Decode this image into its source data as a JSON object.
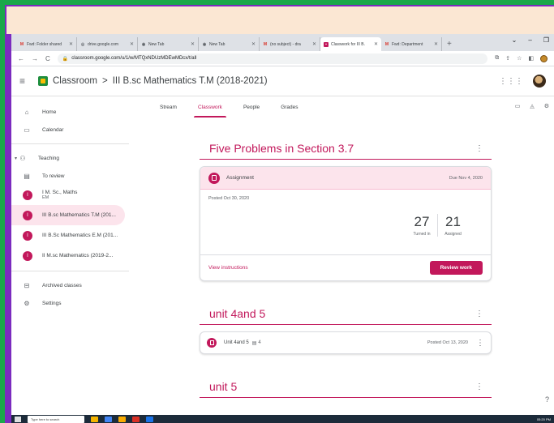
{
  "browser": {
    "tabs": [
      {
        "label": "Fwd: Folder shared",
        "icon": "gmail-icon",
        "active": false
      },
      {
        "label": "drive.google.com",
        "icon": "drive-icon",
        "active": false
      },
      {
        "label": "New Tab",
        "icon": "chrome-icon",
        "active": false
      },
      {
        "label": "New Tab",
        "icon": "chrome-icon",
        "active": false
      },
      {
        "label": "(no subject) - dra",
        "icon": "gmail-icon",
        "active": false
      },
      {
        "label": "Classwork for III B.",
        "icon": "classroom-icon",
        "active": true
      },
      {
        "label": "Fwd: Department",
        "icon": "gmail-icon",
        "active": false
      }
    ],
    "url": "classroom.google.com/u/1/w/MTQxNDUzMDEwMDcx/t/all"
  },
  "header": {
    "app_name": "Classroom",
    "separator": ">",
    "class_name": "III B.sc Mathematics T.M (2018-2021)"
  },
  "subnav": {
    "tabs": [
      {
        "label": "Stream",
        "active": false
      },
      {
        "label": "Classwork",
        "active": true
      },
      {
        "label": "People",
        "active": false
      },
      {
        "label": "Grades",
        "active": false
      }
    ]
  },
  "sidebar": {
    "home": "Home",
    "calendar": "Calendar",
    "teaching": "Teaching",
    "to_review": "To review",
    "classes": [
      {
        "initial": "I",
        "label": "I M. Sc., Maths",
        "sub": "EM",
        "selected": false
      },
      {
        "initial": "I",
        "label": "III B.sc Mathematics T.M (201...",
        "sub": "",
        "selected": true
      },
      {
        "initial": "I",
        "label": "III B.Sc Mathematics E.M (201...",
        "sub": "",
        "selected": false
      },
      {
        "initial": "I",
        "label": "II M.sc Mathematics (2019-2...",
        "sub": "",
        "selected": false
      }
    ],
    "archived": "Archived classes",
    "settings": "Settings"
  },
  "topics": [
    {
      "title": "Five Problems in Section 3.7",
      "assignment": {
        "label": "Assignment",
        "due": "Due Nov 4, 2020",
        "posted": "Posted Oct 30, 2020",
        "turned_in": "27",
        "turned_in_label": "Turned in",
        "assigned": "21",
        "assigned_label": "Assigned",
        "view_instructions": "View instructions",
        "review_work": "Review work"
      }
    },
    {
      "title": "unit 4and 5",
      "material": {
        "label": "Unit 4and 5",
        "comment_count": "4",
        "posted": "Posted Oct 13, 2020"
      }
    },
    {
      "title": "unit 5"
    }
  ],
  "taskbar": {
    "search_placeholder": "Type here to search",
    "time": "05:20 PM"
  },
  "colors": {
    "accent": "#c2185b",
    "frame_green": "#1aa84a",
    "frame_purple": "#7b2bbf"
  }
}
